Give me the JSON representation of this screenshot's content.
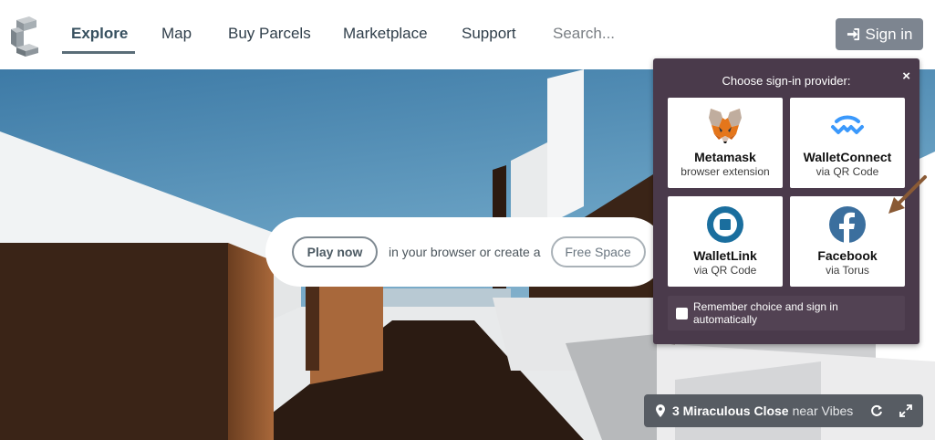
{
  "nav": {
    "items": [
      {
        "label": "Explore",
        "active": true
      },
      {
        "label": "Map",
        "active": false
      },
      {
        "label": "Buy Parcels",
        "active": false
      },
      {
        "label": "Marketplace",
        "active": false
      },
      {
        "label": "Support",
        "active": false
      }
    ],
    "search_placeholder": "Search...",
    "signin_label": "Sign in"
  },
  "hero": {
    "play_label": "Play now",
    "middle_text": "in your browser or create a",
    "free_space_label": "Free Space"
  },
  "location": {
    "name": "3 Miraculous Close",
    "near_text": "near Vibes",
    "icons": [
      "map-pin-icon",
      "refresh-icon",
      "expand-icon"
    ]
  },
  "signin_popup": {
    "title": "Choose sign-in provider:",
    "close_glyph": "×",
    "providers": [
      {
        "name": "Metamask",
        "subtitle": "browser extension",
        "icon": "metamask-fox-icon"
      },
      {
        "name": "WalletConnect",
        "subtitle": "via QR Code",
        "icon": "walletconnect-icon"
      },
      {
        "name": "WalletLink",
        "subtitle": "via QR Code",
        "icon": "walletlink-icon"
      },
      {
        "name": "Facebook",
        "subtitle": "via Torus",
        "icon": "facebook-icon"
      }
    ],
    "remember_label": "Remember choice and sign in automatically",
    "remember_checked": false
  },
  "colors": {
    "popup_bg": "#4a3a4b",
    "signin_button": "#7d8590",
    "walletconnect_blue": "#3b99fc",
    "walletlink_blue": "#1a6e9e",
    "facebook_blue": "#3b6f9e",
    "annotation_arrow": "#8a5a35"
  }
}
